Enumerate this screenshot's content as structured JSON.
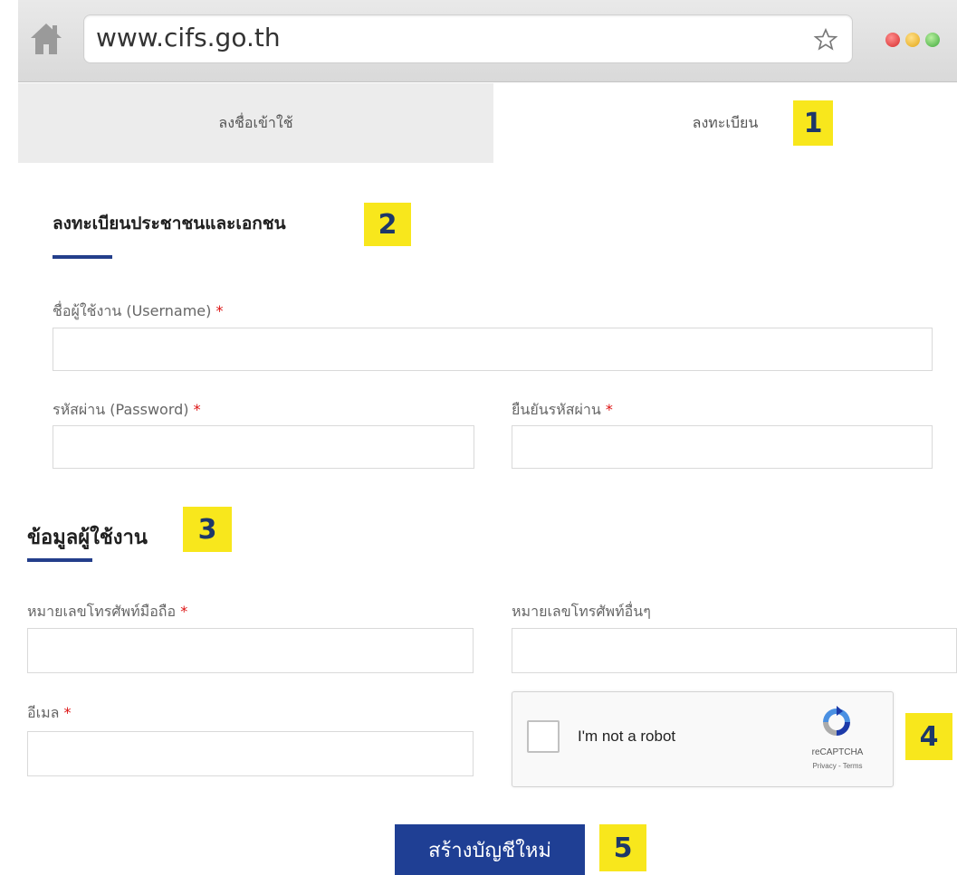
{
  "browser": {
    "url": "www.cifs.go.th",
    "home_icon": "home-icon",
    "bookmark_icon": "star-icon",
    "window_dots": [
      "#d62b2b",
      "#e3a614",
      "#3ea83a"
    ]
  },
  "tabs": {
    "login": "ลงชื่อเข้าใช้",
    "register": "ลงทะเบียน"
  },
  "badges": {
    "b1": "1",
    "b2": "2",
    "b3": "3",
    "b4": "4",
    "b5": "5",
    "color": "#f8e71c"
  },
  "section_account": {
    "title": "ลงทะเบียนประชาชนและเอกชน",
    "username_label": "ชื่อผู้ใช้งาน (Username)",
    "password_label": "รหัสผ่าน (Password)",
    "confirm_label": "ยืนยันรหัสผ่าน",
    "required_mark": "*"
  },
  "section_user": {
    "title": "ข้อมูลผู้ใช้งาน",
    "mobile_label": "หมายเลขโทรศัพท์มือถือ",
    "other_phone_label": "หมายเลขโทรศัพท์อื่นๆ",
    "email_label": "อีเมล",
    "required_mark": "*"
  },
  "recaptcha": {
    "checkbox_label": "I'm not a robot",
    "brand": "reCAPTCHA",
    "links": "Privacy - Terms"
  },
  "submit": {
    "label": "สร้างบัญชีใหม่",
    "color": "#1f3f94"
  }
}
